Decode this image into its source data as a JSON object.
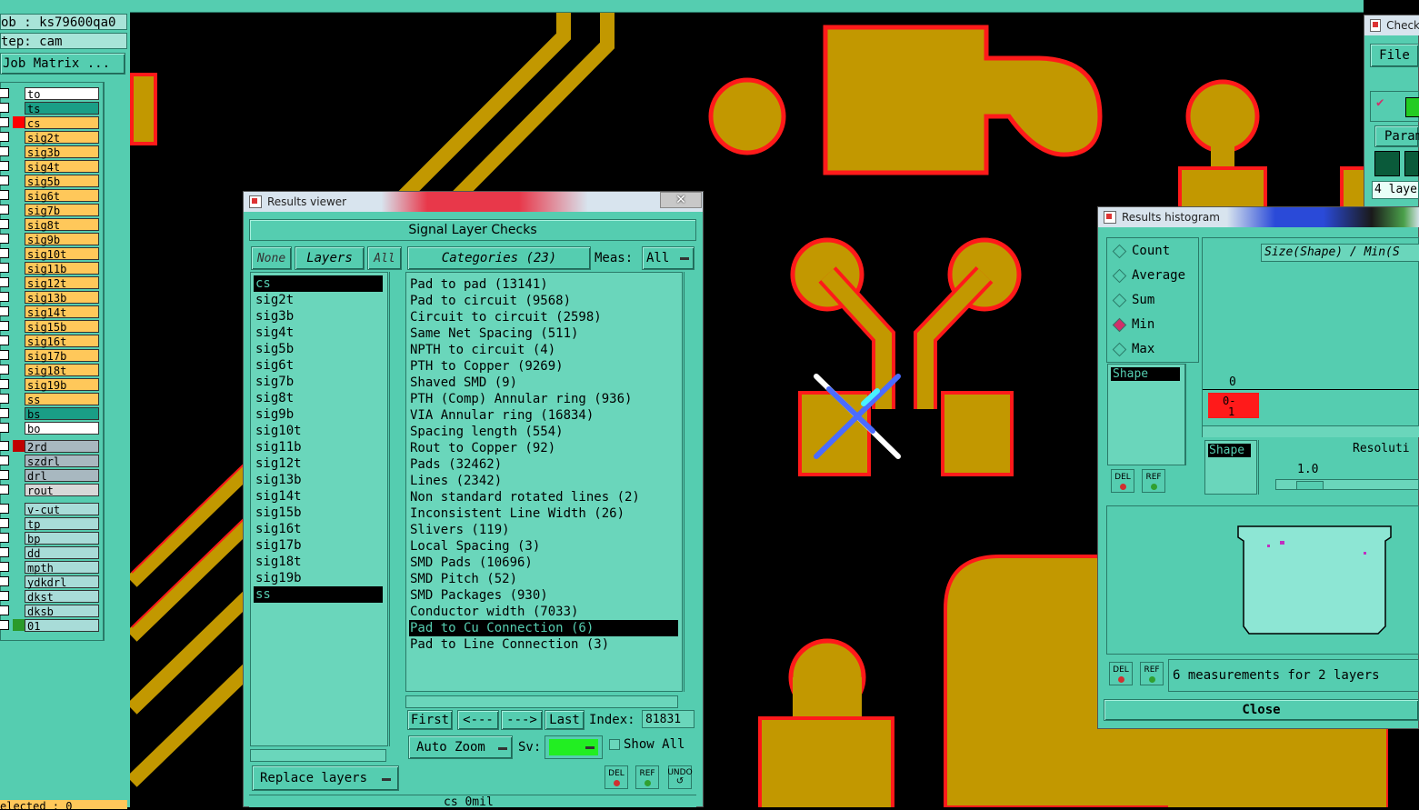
{
  "colors": {
    "copper": "#c29800",
    "outline": "#ff1a1a",
    "panel": "#55cdb0",
    "list_bg": "#6ad6bb"
  },
  "left_panel": {
    "job": "ob : ks79600qa0",
    "step": "tep: cam",
    "matrix_button": "Job Matrix ...",
    "layers": [
      {
        "name": "to",
        "color": "#ffffff",
        "swatch": ""
      },
      {
        "name": "ts",
        "color": "#1a9e86",
        "swatch": ""
      },
      {
        "name": "cs",
        "color": "#ffc85a",
        "swatch": "#ff0000"
      },
      {
        "name": "sig2t",
        "color": "#ffc85a",
        "swatch": ""
      },
      {
        "name": "sig3b",
        "color": "#ffc85a",
        "swatch": ""
      },
      {
        "name": "sig4t",
        "color": "#ffc85a",
        "swatch": ""
      },
      {
        "name": "sig5b",
        "color": "#ffc85a",
        "swatch": ""
      },
      {
        "name": "sig6t",
        "color": "#ffc85a",
        "swatch": ""
      },
      {
        "name": "sig7b",
        "color": "#ffc85a",
        "swatch": ""
      },
      {
        "name": "sig8t",
        "color": "#ffc85a",
        "swatch": ""
      },
      {
        "name": "sig9b",
        "color": "#ffc85a",
        "swatch": ""
      },
      {
        "name": "sig10t",
        "color": "#ffc85a",
        "swatch": ""
      },
      {
        "name": "sig11b",
        "color": "#ffc85a",
        "swatch": ""
      },
      {
        "name": "sig12t",
        "color": "#ffc85a",
        "swatch": ""
      },
      {
        "name": "sig13b",
        "color": "#ffc85a",
        "swatch": ""
      },
      {
        "name": "sig14t",
        "color": "#ffc85a",
        "swatch": ""
      },
      {
        "name": "sig15b",
        "color": "#ffc85a",
        "swatch": ""
      },
      {
        "name": "sig16t",
        "color": "#ffc85a",
        "swatch": ""
      },
      {
        "name": "sig17b",
        "color": "#ffc85a",
        "swatch": ""
      },
      {
        "name": "sig18t",
        "color": "#ffc85a",
        "swatch": ""
      },
      {
        "name": "sig19b",
        "color": "#ffc85a",
        "swatch": ""
      },
      {
        "name": "ss",
        "color": "#ffc85a",
        "swatch": ""
      },
      {
        "name": "bs",
        "color": "#1a9e86",
        "swatch": ""
      },
      {
        "name": "bo",
        "color": "#ffffff",
        "swatch": ""
      }
    ],
    "drill_layers": [
      {
        "name": "2rd",
        "color": "#a8b8c0",
        "swatch": "#c00000"
      },
      {
        "name": "szdrl",
        "color": "#a8b8c0",
        "swatch": ""
      },
      {
        "name": "drl",
        "color": "#a8b8c0",
        "swatch": ""
      },
      {
        "name": "rout",
        "color": "#d8d8d8",
        "swatch": ""
      }
    ],
    "misc_layers": [
      {
        "name": "v-cut",
        "color": "#a8dcd8",
        "swatch": ""
      },
      {
        "name": "tp",
        "color": "#a8dcd8",
        "swatch": ""
      },
      {
        "name": "bp",
        "color": "#a8dcd8",
        "swatch": ""
      },
      {
        "name": "dd",
        "color": "#a8dcd8",
        "swatch": ""
      },
      {
        "name": "mpth",
        "color": "#a8dcd8",
        "swatch": ""
      },
      {
        "name": "ydkdrl",
        "color": "#a8dcd8",
        "swatch": ""
      },
      {
        "name": "dkst",
        "color": "#a8dcd8",
        "swatch": ""
      },
      {
        "name": "dksb",
        "color": "#a8dcd8",
        "swatch": ""
      },
      {
        "name": "01",
        "color": "#a8dcd8",
        "swatch": "#2a9a2a"
      }
    ],
    "selected_text": "elected : 0"
  },
  "results_viewer": {
    "window_title": "Results viewer",
    "header": "Signal Layer Checks",
    "none_btn": "None",
    "layers_btn": "Layers",
    "all_btn": "All",
    "categories_btn": "Categories (23)",
    "meas_label": "Meas:",
    "meas_value": "All",
    "layers": [
      "cs",
      "sig2t",
      "sig3b",
      "sig4t",
      "sig5b",
      "sig6t",
      "sig7b",
      "sig8t",
      "sig9b",
      "sig10t",
      "sig11b",
      "sig12t",
      "sig13b",
      "sig14t",
      "sig15b",
      "sig16t",
      "sig17b",
      "sig18t",
      "sig19b",
      "ss"
    ],
    "categories": [
      "Pad to pad (13141)",
      "Pad to circuit (9568)",
      "Circuit to circuit (2598)",
      "Same Net Spacing (511)",
      "NPTH to circuit (4)",
      "PTH to Copper (9269)",
      "Shaved SMD (9)",
      "PTH (Comp) Annular ring (936)",
      "VIA Annular ring (16834)",
      "Spacing length (554)",
      "Rout to Copper (92)",
      "Pads (32462)",
      "Lines (2342)",
      "Non standard rotated lines (2)",
      "Inconsistent Line Width (26)",
      "Slivers (119)",
      "Local Spacing (3)",
      "SMD Pads (10696)",
      "SMD Pitch (52)",
      "SMD Packages (930)",
      "Conductor width (7033)",
      "Pad to Cu Connection (6)",
      "Pad to Line Connection (3)"
    ],
    "first_btn": "First",
    "prev_btn": "<---",
    "next_btn": "--->",
    "last_btn": "Last",
    "index_label": "Index:",
    "index_value": "81831",
    "auto_zoom": "Auto Zoom",
    "sv_label": "Sv:",
    "show_all": "Show All",
    "replace_layers": "Replace layers",
    "del_label": "DEL",
    "ref_label": "REF",
    "undo_label": "UNDO",
    "status": "cs 0mil"
  },
  "histogram": {
    "window_title": "Results histogram",
    "options": [
      "Count",
      "Average",
      "Sum",
      "Min",
      "Max"
    ],
    "selected_option": "Min",
    "header": "Size(Shape) / Min(S",
    "axis_zero": "0",
    "bar_top": "0-",
    "bar_bottom": "1",
    "shape_item": "Shape",
    "shape_label": "Shape",
    "resolution_label": "Resoluti",
    "resolution_value": "1.0",
    "measurements": "6 measurements for 2 layers",
    "close": "Close",
    "del_label": "DEL",
    "ref_label": "REF"
  },
  "check_window": {
    "title": "Check",
    "file_menu": "File",
    "param_btn": "Param",
    "layers_field": "4 laye"
  }
}
